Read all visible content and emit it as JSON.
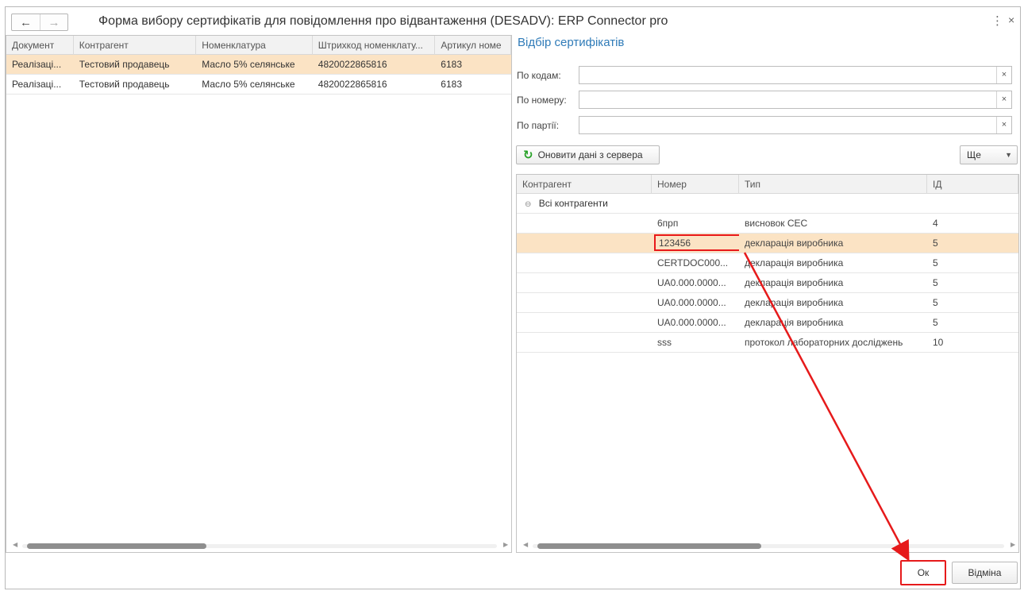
{
  "window": {
    "title": "Форма вибору сертифікатів для повідомлення про відвантаження (DESADV): ERP Connector pro",
    "back": "←",
    "forward": "→",
    "menu": "⋮",
    "close": "×"
  },
  "left_table": {
    "columns": [
      "Документ",
      "Контрагент",
      "Номенклатура",
      "Штрихкод номенклату...",
      "Артикул номе"
    ],
    "rows": [
      [
        "Реалізаці...",
        "Тестовий продавець",
        "Масло 5% селянське",
        "4820022865816",
        "6183"
      ],
      [
        "Реалізаці...",
        "Тестовий продавець",
        "Масло 5% селянське",
        "4820022865816",
        "6183"
      ]
    ],
    "selected_row": 0
  },
  "filters": {
    "title": "Відбір сертифікатів",
    "by_codes": {
      "label": "По кодам:",
      "value": ""
    },
    "by_number": {
      "label": "По номеру:",
      "value": ""
    },
    "by_batch": {
      "label": "По партії:",
      "value": ""
    },
    "clear": "×"
  },
  "toolbar": {
    "refresh_label": "Оновити дані з сервера",
    "more_label": "Ще"
  },
  "cert_table": {
    "columns": [
      "Контрагент",
      "Номер",
      "Тип",
      "ІД"
    ],
    "group_label": "Всі контрагенти",
    "rows": [
      [
        "",
        "6прп",
        "висновок СЕС",
        "4"
      ],
      [
        "",
        "123456",
        "декларація виробника",
        "5"
      ],
      [
        "",
        "CERTDOC000...",
        "декларація виробника",
        "5"
      ],
      [
        "",
        "UA0.000.0000...",
        "декларація виробника",
        "5"
      ],
      [
        "",
        "UA0.000.0000...",
        "декларація виробника",
        "5"
      ],
      [
        "",
        "UA0.000.0000...",
        "декларація виробника",
        "5"
      ],
      [
        "",
        "sss",
        "протокол лабораторних досліджень",
        "10"
      ]
    ],
    "selected_row": 1
  },
  "footer": {
    "ok_label": "Ок",
    "cancel_label": "Відміна"
  },
  "colors": {
    "selection": "#fbe3c4",
    "accent_title": "#2f7bb8",
    "annotation": "#e61a1b"
  }
}
